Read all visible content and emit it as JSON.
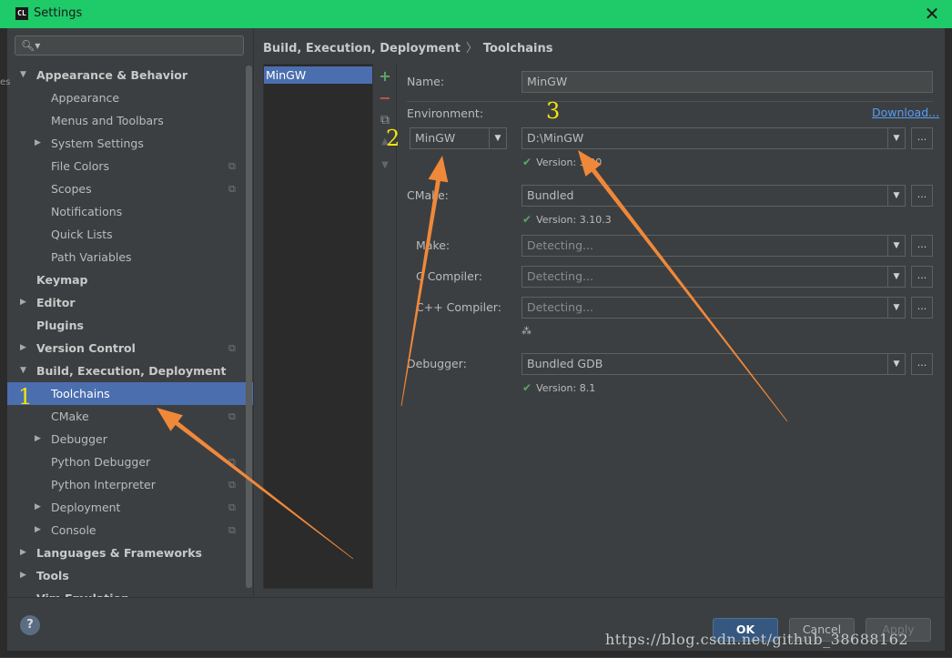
{
  "window": {
    "title": "Settings",
    "logo": "CL",
    "close_glyph": "✕"
  },
  "search": {
    "icon": "search-icon",
    "placeholder": ""
  },
  "left_stub": "es",
  "sidebar": {
    "items": [
      {
        "label": "Appearance & Behavior",
        "level": 0,
        "arrow": "down",
        "bold": true
      },
      {
        "label": "Appearance",
        "level": 1
      },
      {
        "label": "Menus and Toolbars",
        "level": 1
      },
      {
        "label": "System Settings",
        "level": 1,
        "arrow": "right"
      },
      {
        "label": "File Colors",
        "level": 1,
        "copy": true
      },
      {
        "label": "Scopes",
        "level": 1,
        "copy": true
      },
      {
        "label": "Notifications",
        "level": 1
      },
      {
        "label": "Quick Lists",
        "level": 1
      },
      {
        "label": "Path Variables",
        "level": 1
      },
      {
        "label": "Keymap",
        "level": 0,
        "bold": true
      },
      {
        "label": "Editor",
        "level": 0,
        "arrow": "right",
        "bold": true
      },
      {
        "label": "Plugins",
        "level": 0,
        "bold": true
      },
      {
        "label": "Version Control",
        "level": 0,
        "arrow": "right",
        "bold": true,
        "copy": true
      },
      {
        "label": "Build, Execution, Deployment",
        "level": 0,
        "arrow": "down",
        "bold": true
      },
      {
        "label": "Toolchains",
        "level": 1,
        "selected": true
      },
      {
        "label": "CMake",
        "level": 1,
        "copy": true
      },
      {
        "label": "Debugger",
        "level": 1,
        "arrow": "right"
      },
      {
        "label": "Python Debugger",
        "level": 1,
        "copy": true
      },
      {
        "label": "Python Interpreter",
        "level": 1,
        "copy": true
      },
      {
        "label": "Deployment",
        "level": 1,
        "arrow": "right",
        "copy": true
      },
      {
        "label": "Console",
        "level": 1,
        "arrow": "right",
        "copy": true
      },
      {
        "label": "Languages & Frameworks",
        "level": 0,
        "arrow": "right",
        "bold": true
      },
      {
        "label": "Tools",
        "level": 0,
        "arrow": "right",
        "bold": true
      },
      {
        "label": "Vim Emulation",
        "level": 0,
        "bold": true
      }
    ]
  },
  "breadcrumb": {
    "parent": "Build, Execution, Deployment",
    "separator": "〉",
    "current": "Toolchains"
  },
  "toolchains": {
    "items": [
      "MinGW"
    ]
  },
  "toolbar": {
    "add": "+",
    "remove": "−",
    "copy": "⧉",
    "up": "▲",
    "down": "▼"
  },
  "form": {
    "name_label": "Name:",
    "name_value": "MinGW",
    "env_label": "Environment:",
    "download_link": "Download...",
    "env_type": "MinGW",
    "env_path": "D:\\MinGW",
    "env_version": "Version: 3.20",
    "cmake_label": "CMake:",
    "cmake_value": "Bundled",
    "cmake_version": "Version: 3.10.3",
    "make_label": "Make:",
    "make_value": "Detecting...",
    "c_label": "C Compiler:",
    "c_value": "Detecting...",
    "cpp_label": "C++ Compiler:",
    "cpp_value": "Detecting...",
    "debugger_label": "Debugger:",
    "debugger_value": "Bundled GDB",
    "debugger_version": "Version: 8.1",
    "dots": "...",
    "check": "✔",
    "spinner": "⁂"
  },
  "annotations": {
    "n1": "1",
    "n2": "2",
    "n3": "3",
    "arrow_color": "#f0883a"
  },
  "footer": {
    "help": "?",
    "ok": "OK",
    "cancel": "Cancel",
    "apply": "Apply"
  },
  "watermark": "https://blog.csdn.net/github_38688162"
}
